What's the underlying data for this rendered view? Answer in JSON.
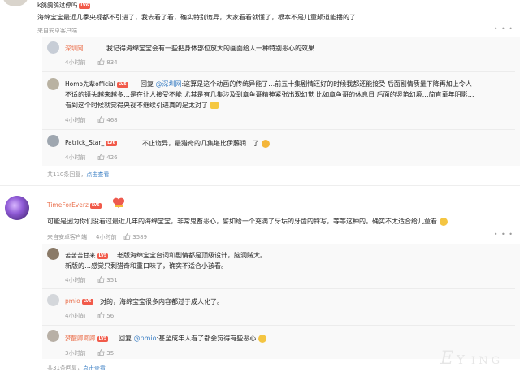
{
  "c1": {
    "user": "k鸽鸽鸽过停吗",
    "level": "LV6",
    "text": "海绵宝宝最近几季央视都不引进了，我去看了看，确实特别诡异，大家看看就懂了，根本不是儿童频道能播的了……",
    "source": "来自安卓客户端",
    "replies": [
      {
        "user": "深圳网",
        "text": "我记得海绵宝宝会有一些把身体部位放大的画面给人一种特别恶心的效果",
        "time": "4小时前",
        "likes": "834"
      },
      {
        "user": "Homo先辈official",
        "level": "LV5",
        "reply_word": "回复",
        "mention": "@深圳网",
        "text_line1": ":这算是这个动画的传统异能了…前五十集剧情还好的时候我都还能接受 后面剧情质量下降再加上令人",
        "text_line2": "不适的镜头越来越多…是在让人接受不能 尤其是有几集涉及到章鱼哥精神紧张出现幻觉 比如章鱼哥的休息日 后面的竖笛幻境…简直童年阴影…",
        "text_line3": "看到这个时候就觉得央视不继续引进真的是太对了",
        "time": "4小时前",
        "likes": "468"
      },
      {
        "user": "Patrick_Star_",
        "level": "LV6",
        "text": "不止诡异，最猎奇的几集堪比伊藤润二了",
        "time": "4小时前",
        "likes": "426"
      }
    ],
    "footer_prefix": "共",
    "footer_count": "110",
    "footer_suffix": "条回复，",
    "footer_link": "点击查看"
  },
  "c2": {
    "user": "TimeForEverz",
    "level": "LV5",
    "text": "可能是因为你们没看过最近几年的海绵宝宝，非常鬼畜恶心，譬如给一个充满了牙垢的牙齿的特写，等等这种的。确实不太适合给儿童看",
    "source": "来自安卓客户端",
    "time": "4小时前",
    "likes": "3589",
    "replies": [
      {
        "user": "苦苦苦甘来",
        "level": "LV5",
        "text_line1": "老版海绵宝宝台词和剧情都是顶级设计，脑洞贼大。",
        "text_line2": "新版的…感觉只剩猎奇和重口味了，确实不适合小孩看。",
        "time": "4小时前",
        "likes": "351"
      },
      {
        "user": "pmio",
        "level": "LV5",
        "text": "对的，海绵宝宝很多内容都过于成人化了。",
        "time": "4小时前",
        "likes": "56"
      },
      {
        "user": "梦醒卿卿卿",
        "level": "LV5",
        "reply_word": "回复",
        "mention": "@pmio",
        "text": ":甚至成年人看了都会觉得有些恶心",
        "time": "3小时前",
        "likes": "35"
      }
    ],
    "footer_prefix": "共",
    "footer_count": "31",
    "footer_suffix": "条回复，",
    "footer_link": "点击查看"
  },
  "colors": {
    "accent_pink": "#eb7350",
    "link_blue": "#3b7fc4",
    "level_red": "#f15a4a"
  }
}
